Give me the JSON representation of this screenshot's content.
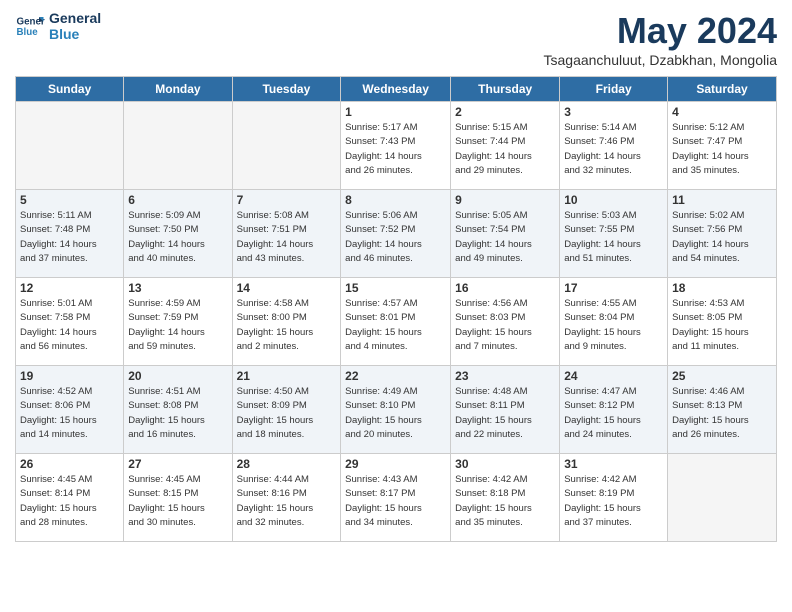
{
  "header": {
    "logo_line1": "General",
    "logo_line2": "Blue",
    "month": "May 2024",
    "location": "Tsagaanchuluut, Dzabkhan, Mongolia"
  },
  "weekdays": [
    "Sunday",
    "Monday",
    "Tuesday",
    "Wednesday",
    "Thursday",
    "Friday",
    "Saturday"
  ],
  "weeks": [
    [
      {
        "day": "",
        "info": ""
      },
      {
        "day": "",
        "info": ""
      },
      {
        "day": "",
        "info": ""
      },
      {
        "day": "1",
        "info": "Sunrise: 5:17 AM\nSunset: 7:43 PM\nDaylight: 14 hours\nand 26 minutes."
      },
      {
        "day": "2",
        "info": "Sunrise: 5:15 AM\nSunset: 7:44 PM\nDaylight: 14 hours\nand 29 minutes."
      },
      {
        "day": "3",
        "info": "Sunrise: 5:14 AM\nSunset: 7:46 PM\nDaylight: 14 hours\nand 32 minutes."
      },
      {
        "day": "4",
        "info": "Sunrise: 5:12 AM\nSunset: 7:47 PM\nDaylight: 14 hours\nand 35 minutes."
      }
    ],
    [
      {
        "day": "5",
        "info": "Sunrise: 5:11 AM\nSunset: 7:48 PM\nDaylight: 14 hours\nand 37 minutes."
      },
      {
        "day": "6",
        "info": "Sunrise: 5:09 AM\nSunset: 7:50 PM\nDaylight: 14 hours\nand 40 minutes."
      },
      {
        "day": "7",
        "info": "Sunrise: 5:08 AM\nSunset: 7:51 PM\nDaylight: 14 hours\nand 43 minutes."
      },
      {
        "day": "8",
        "info": "Sunrise: 5:06 AM\nSunset: 7:52 PM\nDaylight: 14 hours\nand 46 minutes."
      },
      {
        "day": "9",
        "info": "Sunrise: 5:05 AM\nSunset: 7:54 PM\nDaylight: 14 hours\nand 49 minutes."
      },
      {
        "day": "10",
        "info": "Sunrise: 5:03 AM\nSunset: 7:55 PM\nDaylight: 14 hours\nand 51 minutes."
      },
      {
        "day": "11",
        "info": "Sunrise: 5:02 AM\nSunset: 7:56 PM\nDaylight: 14 hours\nand 54 minutes."
      }
    ],
    [
      {
        "day": "12",
        "info": "Sunrise: 5:01 AM\nSunset: 7:58 PM\nDaylight: 14 hours\nand 56 minutes."
      },
      {
        "day": "13",
        "info": "Sunrise: 4:59 AM\nSunset: 7:59 PM\nDaylight: 14 hours\nand 59 minutes."
      },
      {
        "day": "14",
        "info": "Sunrise: 4:58 AM\nSunset: 8:00 PM\nDaylight: 15 hours\nand 2 minutes."
      },
      {
        "day": "15",
        "info": "Sunrise: 4:57 AM\nSunset: 8:01 PM\nDaylight: 15 hours\nand 4 minutes."
      },
      {
        "day": "16",
        "info": "Sunrise: 4:56 AM\nSunset: 8:03 PM\nDaylight: 15 hours\nand 7 minutes."
      },
      {
        "day": "17",
        "info": "Sunrise: 4:55 AM\nSunset: 8:04 PM\nDaylight: 15 hours\nand 9 minutes."
      },
      {
        "day": "18",
        "info": "Sunrise: 4:53 AM\nSunset: 8:05 PM\nDaylight: 15 hours\nand 11 minutes."
      }
    ],
    [
      {
        "day": "19",
        "info": "Sunrise: 4:52 AM\nSunset: 8:06 PM\nDaylight: 15 hours\nand 14 minutes."
      },
      {
        "day": "20",
        "info": "Sunrise: 4:51 AM\nSunset: 8:08 PM\nDaylight: 15 hours\nand 16 minutes."
      },
      {
        "day": "21",
        "info": "Sunrise: 4:50 AM\nSunset: 8:09 PM\nDaylight: 15 hours\nand 18 minutes."
      },
      {
        "day": "22",
        "info": "Sunrise: 4:49 AM\nSunset: 8:10 PM\nDaylight: 15 hours\nand 20 minutes."
      },
      {
        "day": "23",
        "info": "Sunrise: 4:48 AM\nSunset: 8:11 PM\nDaylight: 15 hours\nand 22 minutes."
      },
      {
        "day": "24",
        "info": "Sunrise: 4:47 AM\nSunset: 8:12 PM\nDaylight: 15 hours\nand 24 minutes."
      },
      {
        "day": "25",
        "info": "Sunrise: 4:46 AM\nSunset: 8:13 PM\nDaylight: 15 hours\nand 26 minutes."
      }
    ],
    [
      {
        "day": "26",
        "info": "Sunrise: 4:45 AM\nSunset: 8:14 PM\nDaylight: 15 hours\nand 28 minutes."
      },
      {
        "day": "27",
        "info": "Sunrise: 4:45 AM\nSunset: 8:15 PM\nDaylight: 15 hours\nand 30 minutes."
      },
      {
        "day": "28",
        "info": "Sunrise: 4:44 AM\nSunset: 8:16 PM\nDaylight: 15 hours\nand 32 minutes."
      },
      {
        "day": "29",
        "info": "Sunrise: 4:43 AM\nSunset: 8:17 PM\nDaylight: 15 hours\nand 34 minutes."
      },
      {
        "day": "30",
        "info": "Sunrise: 4:42 AM\nSunset: 8:18 PM\nDaylight: 15 hours\nand 35 minutes."
      },
      {
        "day": "31",
        "info": "Sunrise: 4:42 AM\nSunset: 8:19 PM\nDaylight: 15 hours\nand 37 minutes."
      },
      {
        "day": "",
        "info": ""
      }
    ]
  ]
}
